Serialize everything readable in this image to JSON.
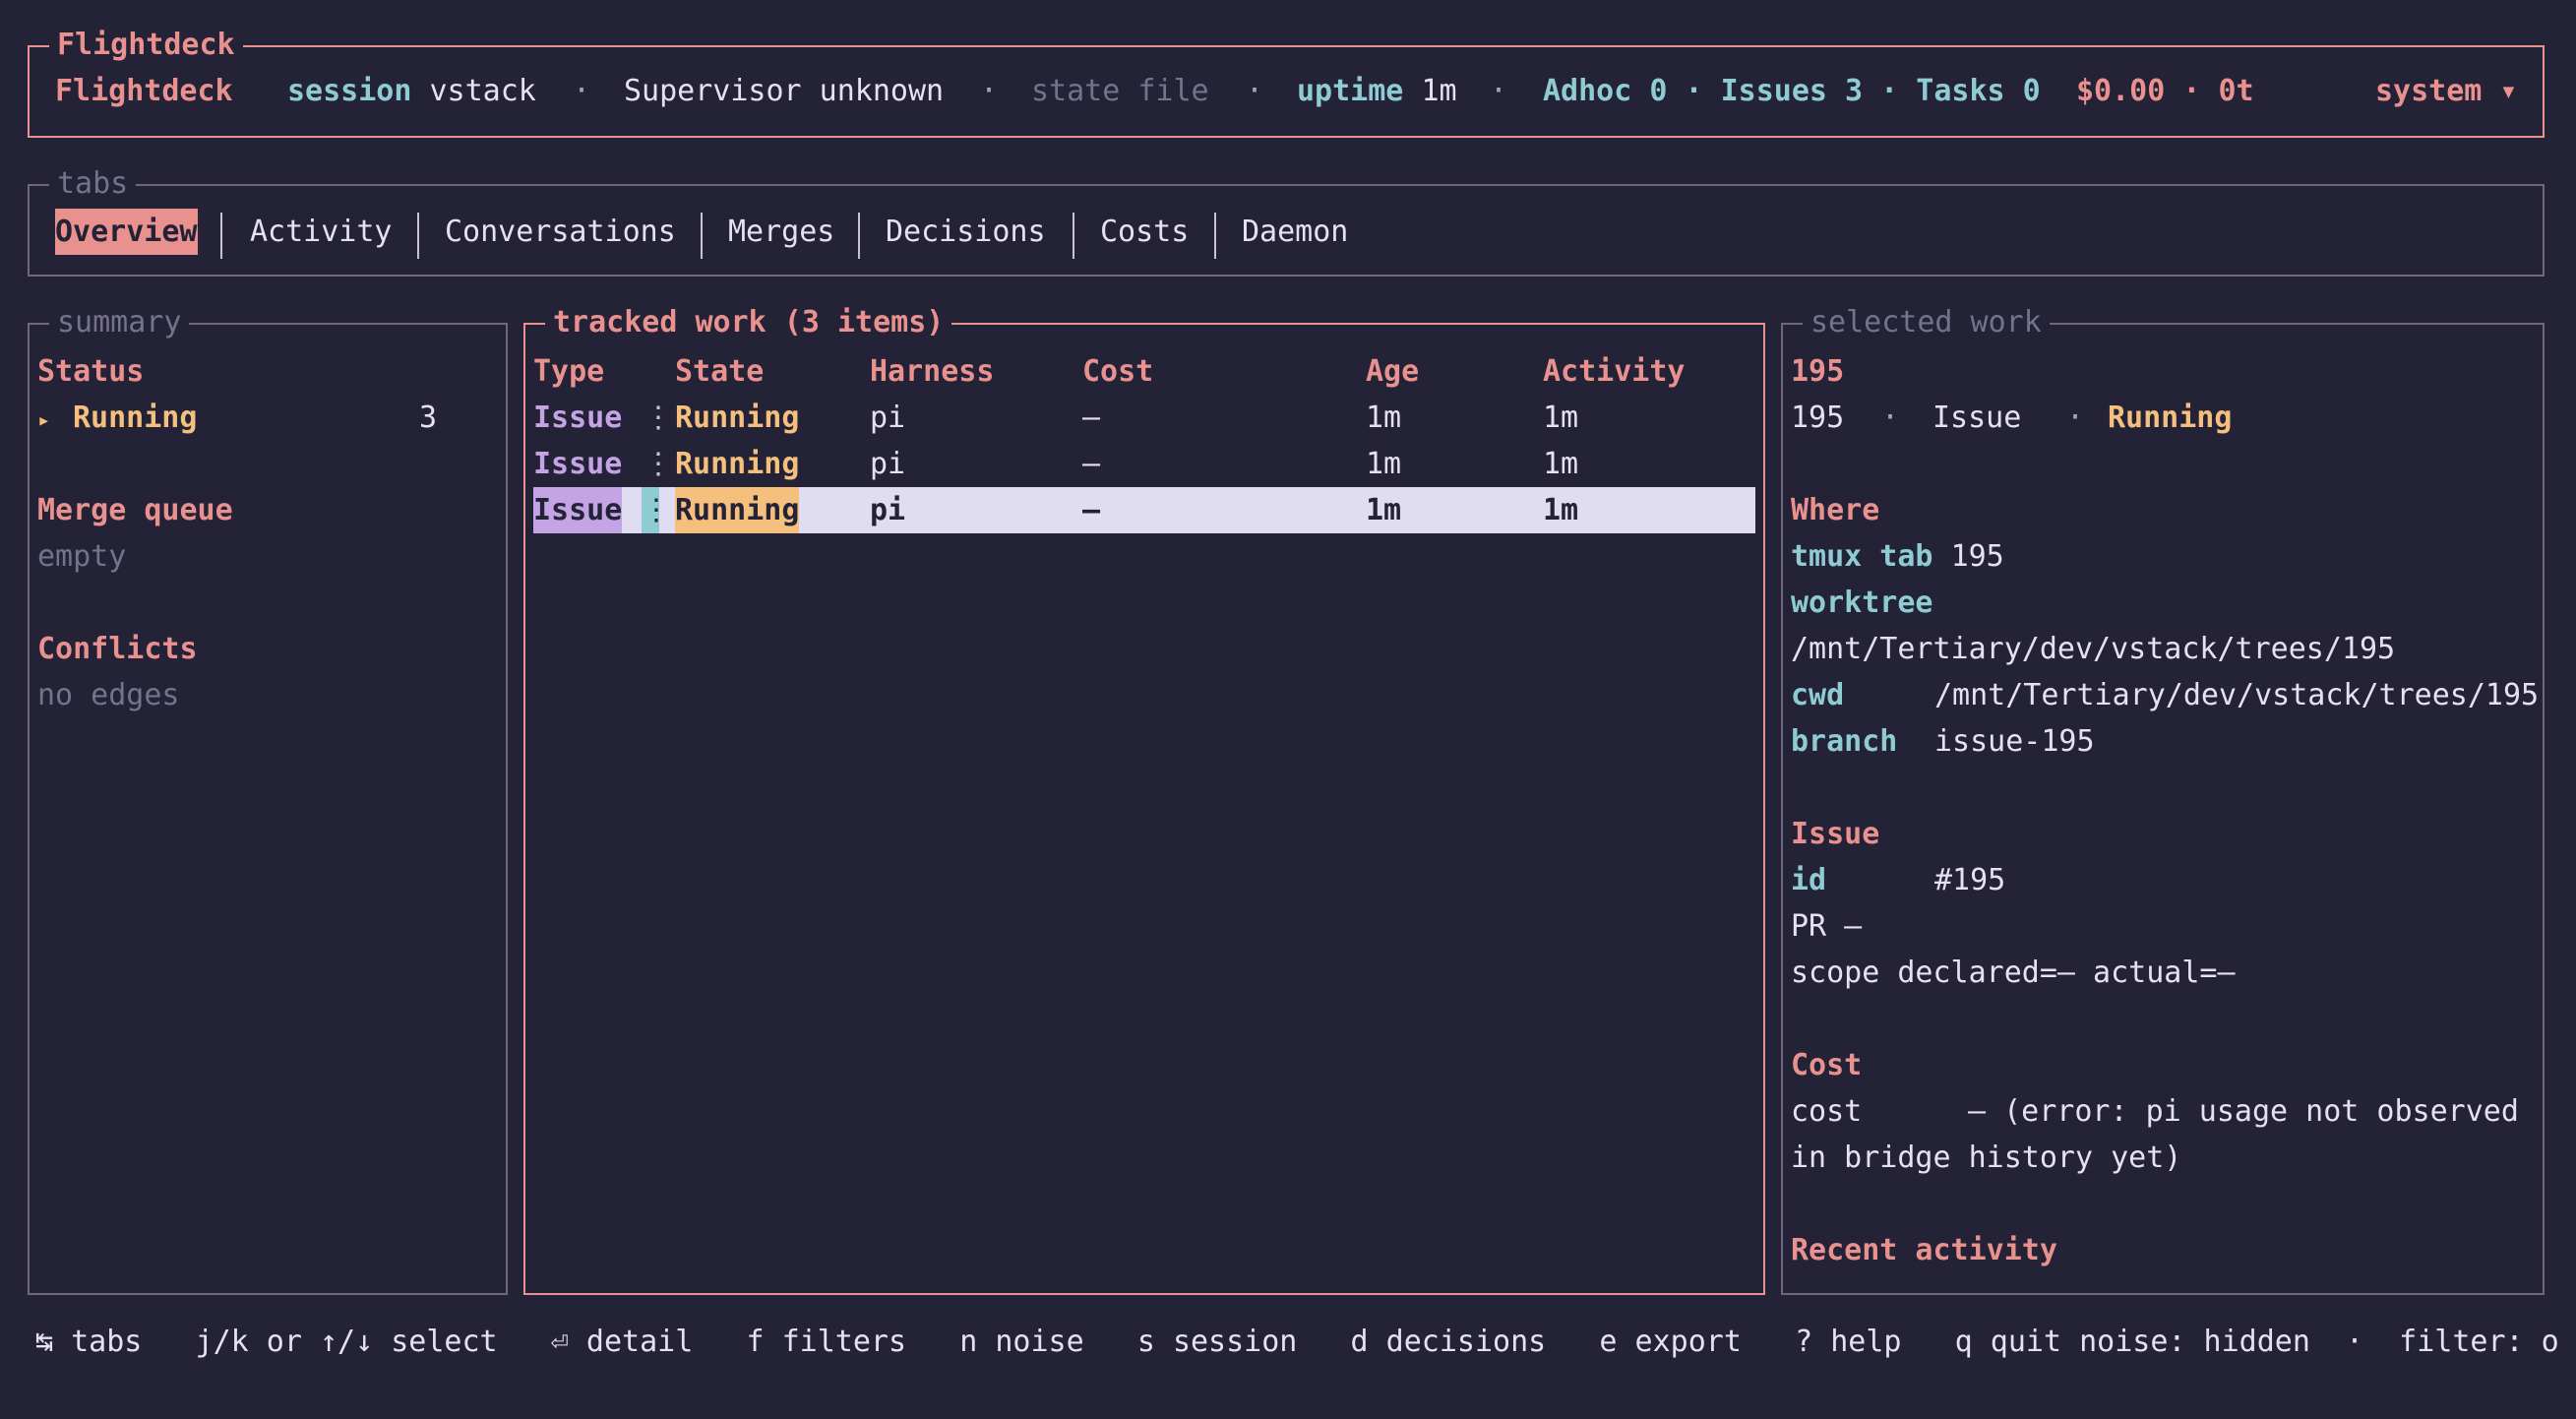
{
  "header": {
    "pane_title": "Flightdeck",
    "app_name": "Flightdeck",
    "session_key": "session",
    "session_val": "vstack",
    "sep": "·",
    "supervisor": "Supervisor unknown",
    "state_file": "state file",
    "uptime_key": "uptime",
    "uptime_val": "1m",
    "counts": "Adhoc 0 · Issues 3 · Tasks 0",
    "cost": "$0.00 · 0t",
    "system_menu": "system ▾"
  },
  "tabs": {
    "pane_title": "tabs",
    "items": [
      "Overview",
      "Activity",
      "Conversations",
      "Merges",
      "Decisions",
      "Costs",
      "Daemon"
    ],
    "selected": "Overview"
  },
  "summary": {
    "pane_title": "summary",
    "status_heading": "Status",
    "status_bullet": "▸",
    "status_label": "Running",
    "status_count": "3",
    "merge_heading": "Merge queue",
    "merge_value": "empty",
    "conflicts_heading": "Conflicts",
    "conflicts_value": "no edges"
  },
  "tracked": {
    "pane_title": "tracked work (3 items)",
    "columns": [
      "Type",
      "State",
      "Harness",
      "Cost",
      "Age",
      "Activity"
    ],
    "marker": "⋮",
    "rows": [
      {
        "type": "Issue",
        "state": "Running",
        "harness": "pi",
        "cost": "—",
        "age": "1m",
        "activity": "1m"
      },
      {
        "type": "Issue",
        "state": "Running",
        "harness": "pi",
        "cost": "—",
        "age": "1m",
        "activity": "1m"
      },
      {
        "type": "Issue",
        "state": "Running",
        "harness": "pi",
        "cost": "—",
        "age": "1m",
        "activity": "1m"
      }
    ],
    "selected_row": 2
  },
  "selected": {
    "pane_title": "selected work",
    "id": "195",
    "summary_id": "195",
    "summary_sep": "·",
    "summary_type": "Issue",
    "summary_state": "Running",
    "where_heading": "Where",
    "tmux_key": "tmux tab",
    "tmux_val": "195",
    "worktree_key": "worktree",
    "worktree_val": "/mnt/Tertiary/dev/vstack/trees/195",
    "cwd_key": "cwd",
    "cwd_val": "/mnt/Tertiary/dev/vstack/trees/195",
    "branch_key": "branch",
    "branch_val": "issue-195",
    "issue_heading": "Issue",
    "id_key": "id",
    "id_val": "#195",
    "pr_line": "PR —",
    "scope_line": "scope declared=— actual=—",
    "cost_heading": "Cost",
    "cost_key": "cost",
    "cost_val": "— (error: pi usage not observed",
    "cost_val2": "in bridge history yet)",
    "recent_heading": "Recent activity"
  },
  "footer": {
    "text": "↹ tabs   j/k or ↑/↓ select   ⏎ detail   f filters   n noise   s session   d decisions   e export   ? help   q quit noise: hidden  ·  filter: o"
  },
  "colors": {
    "background": "#232236",
    "accent": "#e8918e",
    "teal": "#8fcbd3",
    "yellow": "#f5c07d",
    "purple": "#c5a4e6",
    "highlight": "#e0ddf3"
  }
}
